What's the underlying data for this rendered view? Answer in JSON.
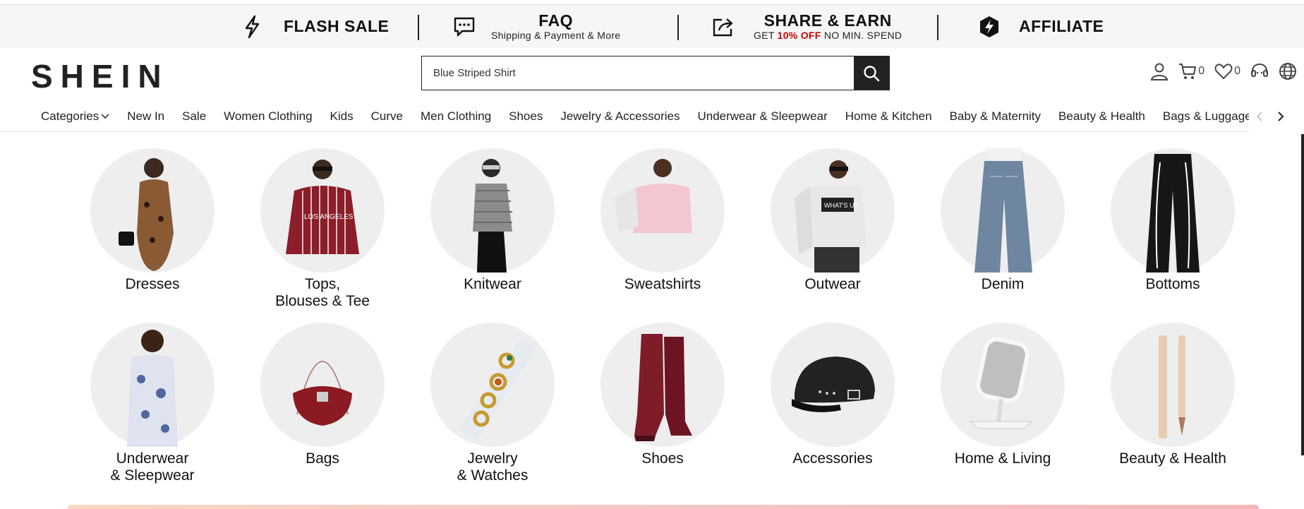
{
  "promo_bar": {
    "flash_sale": {
      "title": "FLASH SALE",
      "icon": "lightning-icon"
    },
    "faq": {
      "title": "FAQ",
      "subtitle": "Shipping & Payment & More",
      "icon": "chat-bubble-icon"
    },
    "share_earn": {
      "title": "SHARE & EARN",
      "subtitle_pre": "GET ",
      "subtitle_highlight": "10% OFF",
      "subtitle_post": " NO MIN. SPEND",
      "icon": "share-icon"
    },
    "affiliate": {
      "title": "AFFILIATE",
      "icon": "affiliate-bolt-icon"
    }
  },
  "header": {
    "logo": "SHEIN",
    "search": {
      "value": "Blue Striped Shirt"
    },
    "cart_count": "0",
    "wishlist_count": "0"
  },
  "nav": {
    "items": [
      "Categories",
      "New In",
      "Sale",
      "Women Clothing",
      "Kids",
      "Curve",
      "Men Clothing",
      "Shoes",
      "Jewelry & Accessories",
      "Underwear & Sleepwear",
      "Home & Kitchen",
      "Baby & Maternity",
      "Beauty & Health",
      "Bags & Luggage"
    ]
  },
  "categories": {
    "row1": [
      "Dresses",
      "Tops,\nBlouses & Tee",
      "Knitwear",
      "Sweatshirts",
      "Outwear",
      "Denim",
      "Bottoms"
    ],
    "row2": [
      "Underwear\n& Sleepwear",
      "Bags",
      "Jewelry\n& Watches",
      "Shoes",
      "Accessories",
      "Home & Living",
      "Beauty & Health"
    ]
  },
  "colors": {
    "accent_red": "#cc0000",
    "dark": "#222222",
    "circle_bg": "#eeeeee",
    "promo_bg": "#f6f6f6"
  }
}
